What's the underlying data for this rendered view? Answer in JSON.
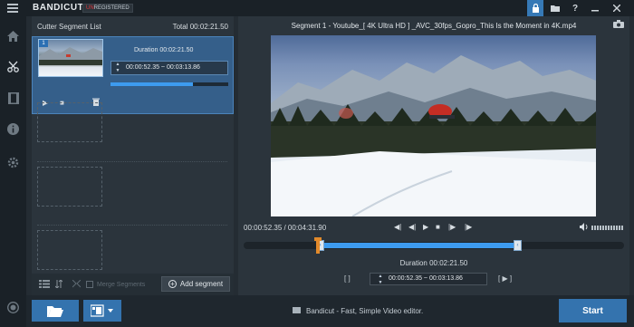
{
  "app": {
    "logo": "BANDICUT",
    "badge_prefix": "UN",
    "badge_rest": "REGISTERED"
  },
  "titlebar_icons": [
    "lock-icon",
    "folder-icon",
    "help-icon",
    "minimize-icon",
    "close-icon"
  ],
  "rail_icons": [
    "home-icon",
    "cut-icon",
    "film-icon",
    "info-icon",
    "settings-icon",
    "record-icon"
  ],
  "segments": {
    "title": "Cutter Segment List",
    "total": "Total 00:02:21.50",
    "item": {
      "number": "1",
      "duration": "Duration 00:02:21.50",
      "range": "00:00:52.35 ~ 00:03:13.86",
      "progress": 0.7
    },
    "merge_label": "Merge Segments",
    "add_label": "Add segment"
  },
  "video": {
    "title": "Segment 1 - Youtube_[ 4K Ultra HD ] _AVC_30fps_Gopro_This Is the Moment in 4K.mp4",
    "time": "00:00:52.35 / 00:04:31.90",
    "duration": "Duration 00:02:21.50",
    "range": "00:00:52.35 ~ 00:03:13.86",
    "bracket_left": "[ ]",
    "bracket_right": "[ ▶ ]"
  },
  "footer": {
    "message": "Bandicut - Fast, Simple Video editor.",
    "start": "Start"
  },
  "colors": {
    "accent": "#3473ae",
    "selection": "#355f8a",
    "timeline": "#3d9bef",
    "playhead": "#e28a2b"
  }
}
